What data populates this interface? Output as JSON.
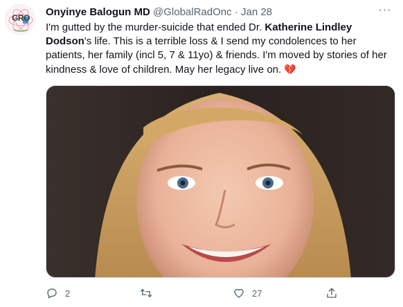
{
  "tweet": {
    "author_name": "Onyinye Balogun MD",
    "author_handle": "@GlobalRadOnc",
    "separator": "·",
    "date": "Jan 28",
    "text_before_bold": "I'm gutted by the murder-suicide that ended Dr. ",
    "text_bold": "Katherine Lindley Dodson",
    "text_after_bold": "'s life. This is a terrible loss & I send my condolences to her patients, her family (incl 5, 7 & 11yo) & friends. I'm moved by stories of her kindness & love of children. May her legacy live on. ",
    "emoji": "💔",
    "avatar_text": "GRO",
    "more_label": "···"
  },
  "actions": {
    "reply_count": "2",
    "retweet_count": "",
    "like_count": "27",
    "reply_icon": "reply-icon",
    "retweet_icon": "retweet-icon",
    "like_icon": "heart-icon",
    "share_icon": "share-icon"
  },
  "colors": {
    "text": "#0f1419",
    "secondary": "#536471",
    "border": "#cfd9de",
    "heart": "#e0245e"
  }
}
